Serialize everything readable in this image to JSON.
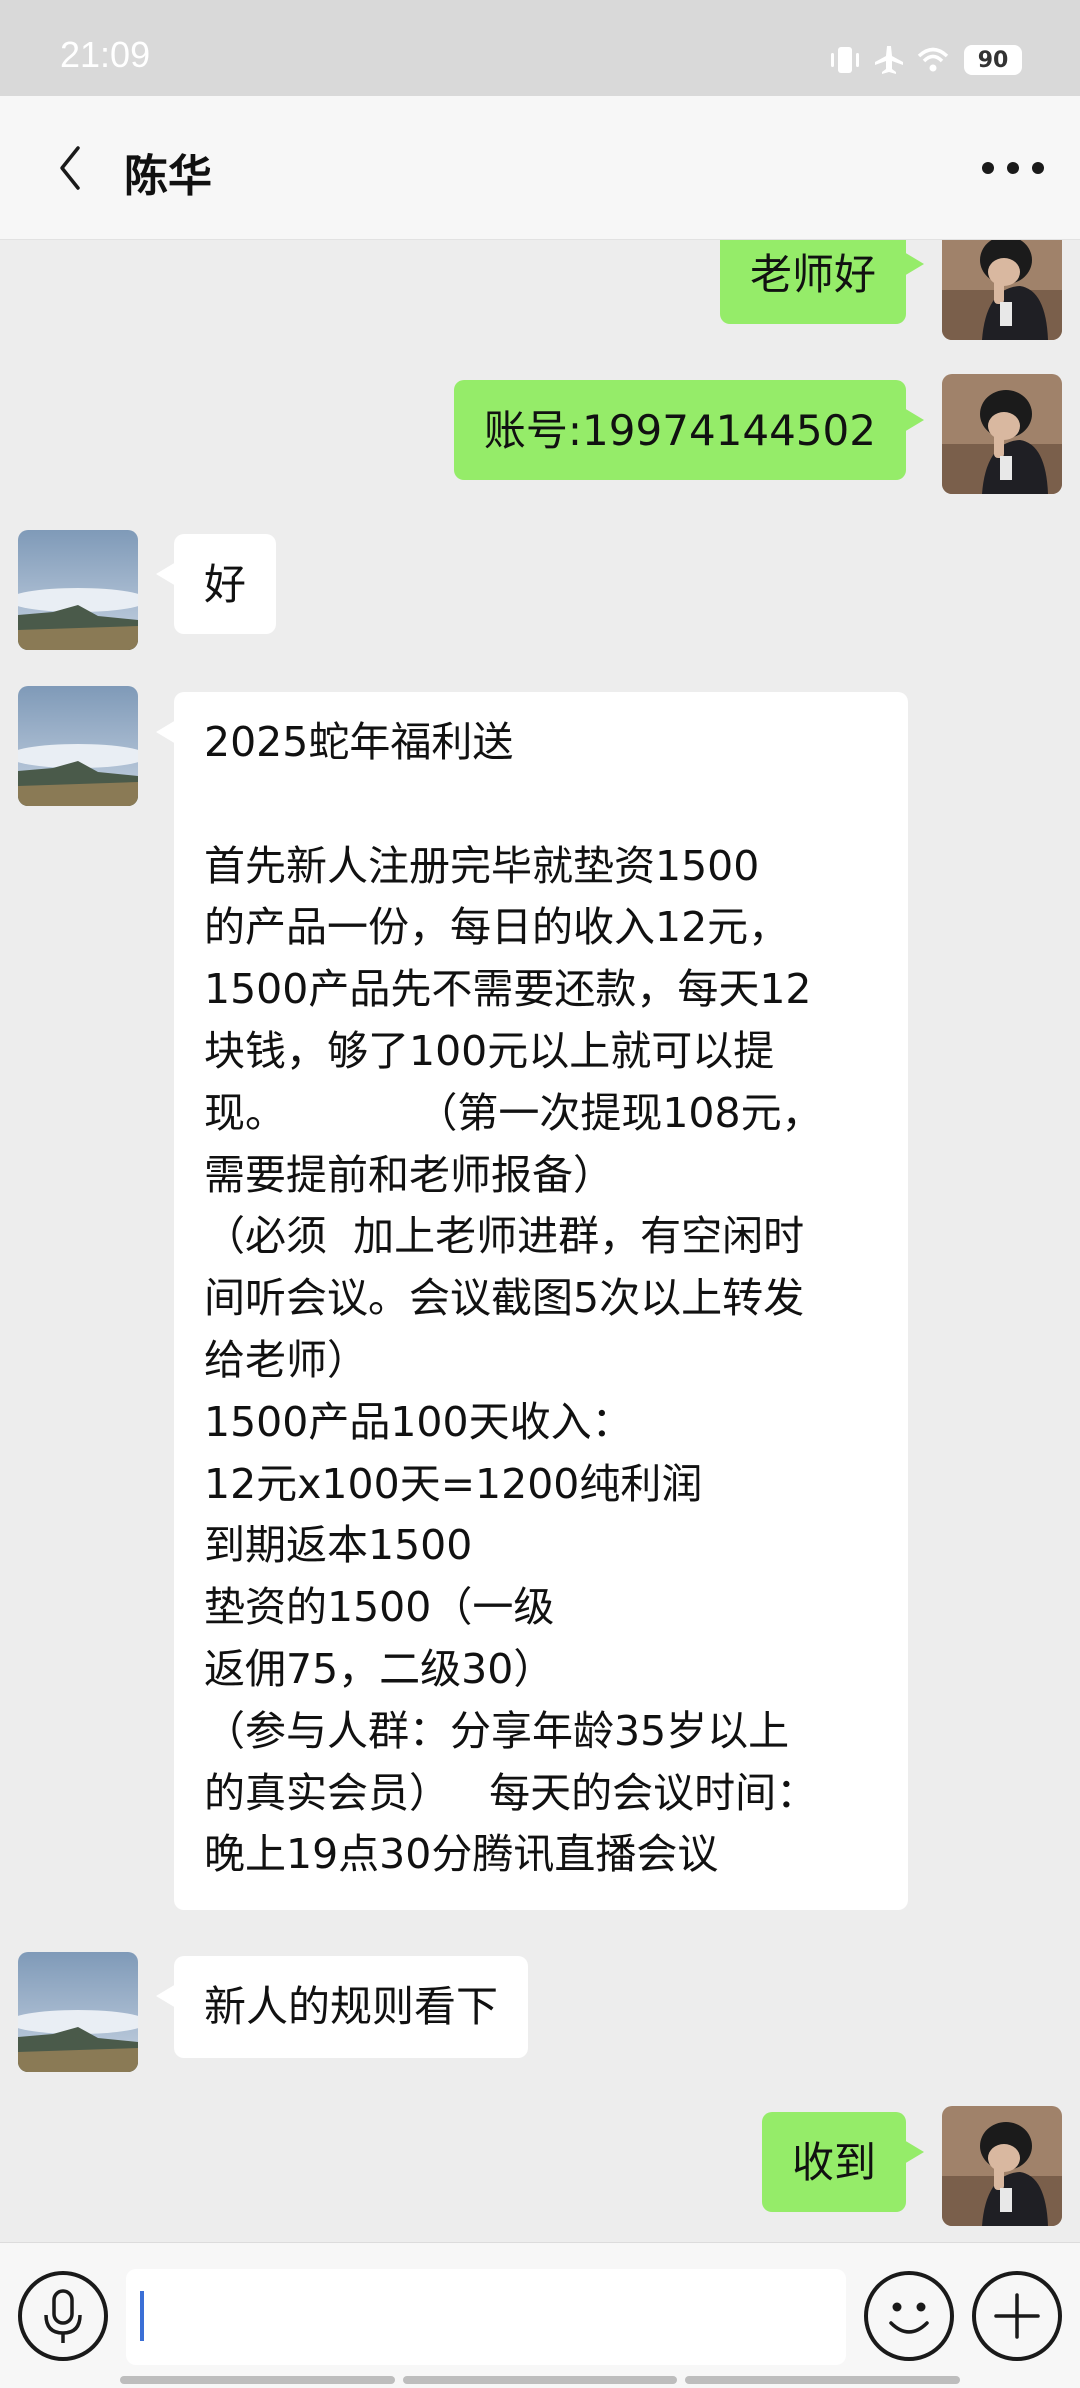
{
  "status_bar": {
    "time": "21:09",
    "battery": "90",
    "icons": [
      "vibrate-icon",
      "airplane-icon",
      "wifi-icon",
      "battery-icon"
    ]
  },
  "header": {
    "title": "陈华",
    "back_icon": "chevron-left-icon",
    "more_icon": "more-dots-icon"
  },
  "messages": [
    {
      "id": "m1",
      "side": "out",
      "text": "老师好"
    },
    {
      "id": "m2",
      "side": "out",
      "text": "账号:19974144502"
    },
    {
      "id": "m3",
      "side": "in",
      "text": "好"
    },
    {
      "id": "m4",
      "side": "in",
      "text": "2025蛇年福利送\n\n首先新人注册完毕就垫资1500\n的产品一份，每日的收入12元，\n1500产品先不需要还款，每天12\n块钱，够了100元以上就可以提\n现。          （第一次提现108元，\n需要提前和老师报备）\n（必须  加上老师进群，有空闲时\n间听会议。会议截图5次以上转发\n给老师）\n1500产品100天收入：\n12元x100天=1200纯利润\n到期返本1500\n垫资的1500（一级\n返佣75，二级30）\n（参与人群：分享年龄35岁以上\n的真实会员）   每天的会议时间：\n晚上19点30分腾讯直播会议"
    },
    {
      "id": "m5",
      "side": "in",
      "text": "新人的规则看下"
    },
    {
      "id": "m6",
      "side": "out",
      "text": "收到"
    }
  ],
  "input_bar": {
    "value": "",
    "voice_icon": "microphone-icon",
    "emoji_icon": "smiley-icon",
    "plus_icon": "plus-icon"
  },
  "colors": {
    "background": "#ededed",
    "outgoing_bubble": "#95ec69",
    "incoming_bubble": "#ffffff",
    "caret": "#3b6fd6"
  }
}
